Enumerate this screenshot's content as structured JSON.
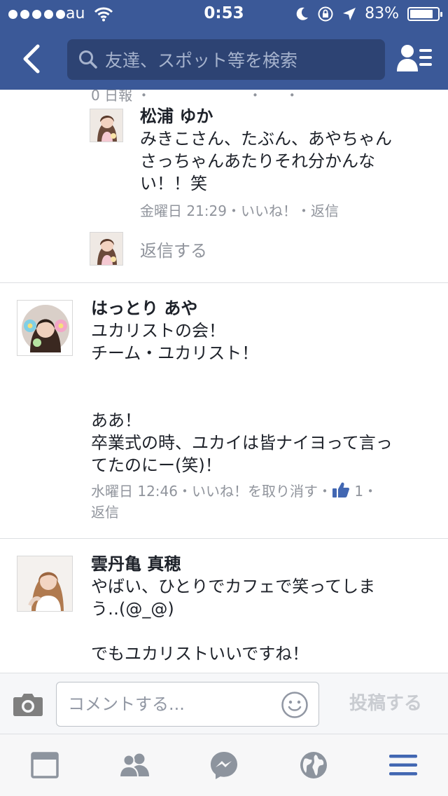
{
  "status": {
    "carrier": "au",
    "time": "0:53",
    "battery_percent": "83%",
    "battery_level": 0.83
  },
  "nav": {
    "search_placeholder": "友達、スポット等を検索"
  },
  "thread": {
    "cut_text": "0 日報 ・ 　　　 　　　 ・ 　 ・ 　",
    "reply": {
      "author": "松浦 ゆか",
      "text": "みきこさん、たぶん、あやちゃん\nさっちゃんあたりそれ分かんな\nい！！笑",
      "time": "金曜日 21:29",
      "like": "いいね！",
      "reply": "返信"
    },
    "reply_placeholder": "返信する"
  },
  "comments": [
    {
      "author": "はっとり あや",
      "text": "ユカリストの会！\nチーム・ユカリスト！\n\n\nああ！\n卒業式の時、ユカイは皆ナイヨって言っ\nてたのにー(笑)！",
      "time": "水曜日 12:46",
      "like": "いいね！を取り消す",
      "like_count": "1",
      "reply": "返信"
    },
    {
      "author": "雲丹亀 真穂",
      "text": "やばい、ひとりでカフェで笑ってしま\nう‥(@_@)\n\nでもユカリストいいですね！"
    }
  ],
  "composer": {
    "placeholder": "コメントする...",
    "post_label": "投稿する"
  },
  "icons": {
    "back": "chevron-left-icon",
    "search": "search-icon",
    "profile": "friend-requests-icon",
    "camera": "camera-icon",
    "smile": "emoji-icon",
    "news_feed": "news-feed-icon",
    "friends": "friends-icon",
    "messenger": "messenger-icon",
    "notifications": "globe-icon",
    "menu": "menu-icon"
  },
  "colors": {
    "brand": "#3b5998",
    "active_tab": "#4267b2",
    "like_blue": "#4267b2"
  }
}
